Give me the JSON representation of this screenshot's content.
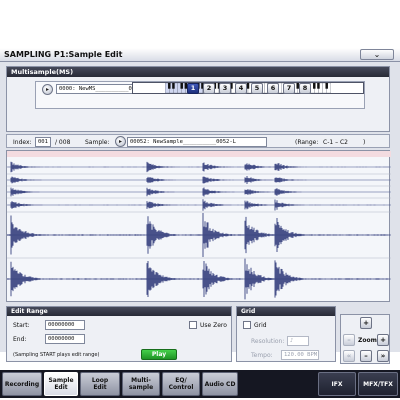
{
  "header": {
    "title": "SAMPLING P1:Sample Edit",
    "menu_icon": "chevron-down-icon"
  },
  "multisample": {
    "title": "Multisample(MS)",
    "ms_value": "0000: NewMS__________000-L",
    "slots": [
      "1",
      "2",
      "3",
      "4",
      "5",
      "6",
      "7",
      "8"
    ],
    "active_slot": "1"
  },
  "index_row": {
    "index_label": "Index:",
    "index_value": "001",
    "index_total": "/ 008",
    "sample_label": "Sample:",
    "sample_value": "00052: NewSample__________0052-L",
    "range_label": "(Range:",
    "range_value": "C-1  –  C2",
    "range_close": ")"
  },
  "edit_range": {
    "title": "Edit Range",
    "start_label": "Start:",
    "start_value": "00000000",
    "end_label": "End:",
    "end_value": "00000000",
    "use_zero_label": "Use Zero",
    "note": "(Sampling START plays edit range)",
    "play_label": "Play"
  },
  "grid": {
    "title": "Grid",
    "grid_label": "Grid",
    "resolution_label": "Resolution:",
    "resolution_value": "♪",
    "tempo_label": "Tempo:",
    "tempo_value": "120.00 BPM"
  },
  "zoom": {
    "label": "Zoom",
    "plus": "+",
    "minus": "–",
    "left": "«",
    "right": "»"
  },
  "tabs": [
    {
      "label": "Recording"
    },
    {
      "label": "Sample\nEdit"
    },
    {
      "label": "Loop\nEdit"
    },
    {
      "label": "Multi-\nsample"
    },
    {
      "label": "EQ/\nControl"
    },
    {
      "label": "Audio CD"
    },
    {
      "label": "IFX"
    },
    {
      "label": "MFX/TFX"
    }
  ],
  "active_tab": "Sample\nEdit",
  "colors": {
    "accent": "#2a3f99",
    "play": "#2eb034",
    "waveform": "#1e2a6e",
    "header_dark": "#2d303d"
  }
}
